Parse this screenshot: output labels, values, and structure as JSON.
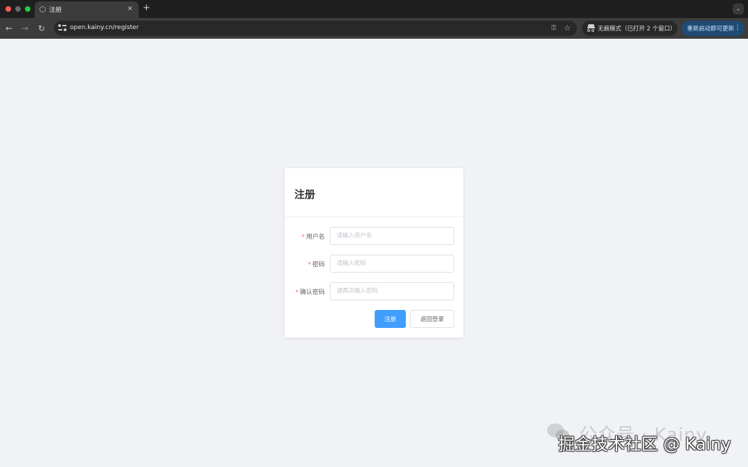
{
  "browser": {
    "tab_title": "注册",
    "tab_close": "×",
    "new_tab": "+",
    "tab_search_icon": "⌄",
    "url": "open.kainy.cn/register",
    "back_icon": "←",
    "forward_icon": "→",
    "reload_icon": "↻",
    "key_icon": "⚿",
    "star_icon": "☆",
    "incognito_text": "无痕模式（已打开 2 个窗口）",
    "update_text": "重新启动即可更新",
    "more_icon": "⋮"
  },
  "form": {
    "title": "注册",
    "required_mark": "*",
    "fields": [
      {
        "label": "用户名",
        "placeholder": "请输入用户名",
        "value": ""
      },
      {
        "label": "密码",
        "placeholder": "请输入密码",
        "value": ""
      },
      {
        "label": "确认密码",
        "placeholder": "请再次输入密码",
        "value": ""
      }
    ],
    "submit_label": "注册",
    "back_label": "返回登录"
  },
  "watermark": {
    "faint_text": "公众号 · Kainy",
    "main_text": "掘金技术社区 @ Kainy"
  },
  "colors": {
    "primary": "#409eff",
    "required": "#f56c6c",
    "page_bg": "#f0f2f5"
  }
}
